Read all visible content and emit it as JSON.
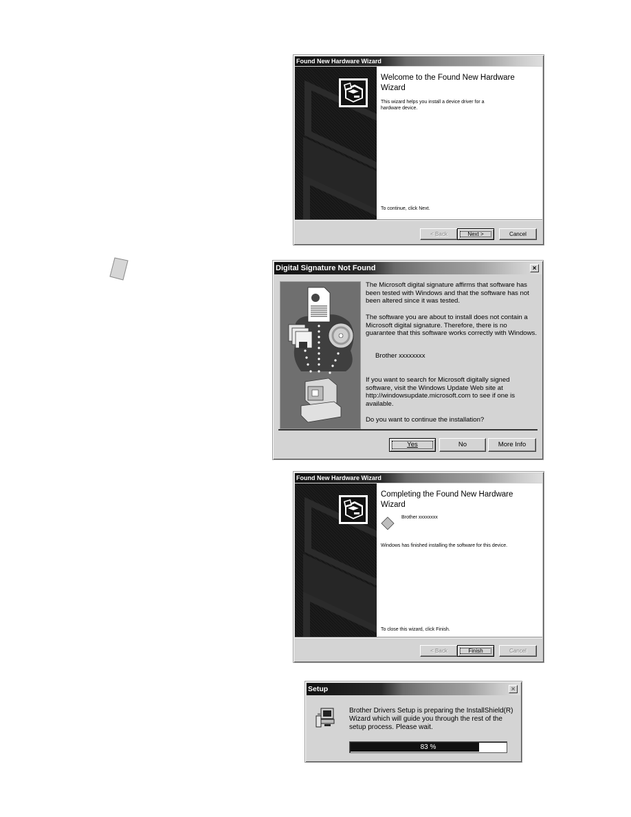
{
  "note_icon": "note-page-icon",
  "wizard_welcome": {
    "title": "Found New Hardware Wizard",
    "heading": "Welcome to the Found New Hardware Wizard",
    "description": "This wizard helps you install a device driver for a hardware device.",
    "footer": "To continue, click Next.",
    "icon": "hardware-box-icon",
    "buttons": {
      "back": "< Back",
      "next": "Next >",
      "cancel": "Cancel"
    }
  },
  "signature_dialog": {
    "title": "Digital Signature Not Found",
    "close_label": "×",
    "paragraph1": "The Microsoft digital signature affirms that software has been tested with Windows and that the software has not been altered since it was tested.",
    "paragraph2": "The software you are about to install does not contain a Microsoft digital signature. Therefore, there is no guarantee that this software works correctly with Windows.",
    "device_name": "Brother xxxxxxxx",
    "paragraph3": "If you want to search for Microsoft digitally signed software, visit the Windows Update Web site at http://windowsupdate.microsoft.com to see if one is available.",
    "question": "Do you want to continue the installation?",
    "illustration": "signature-illustration",
    "buttons": {
      "yes": "Yes",
      "no": "No",
      "more_info": "More Info"
    }
  },
  "wizard_complete": {
    "title": "Found New Hardware Wizard",
    "heading": "Completing the Found New Hardware Wizard",
    "device_name": "Brother xxxxxxxx",
    "status": "Windows has finished installing the software for this device.",
    "footer": "To close this wizard, click Finish.",
    "icon": "hardware-box-icon",
    "buttons": {
      "back": "< Back",
      "finish": "Finish",
      "cancel": "Cancel"
    }
  },
  "setup_dialog": {
    "title": "Setup",
    "close_label": "×",
    "message": "Brother Drivers Setup is preparing the InstallShield(R) Wizard which will guide you through the rest of the setup process.  Please wait.",
    "progress_percent": 83,
    "progress_label": "83 %"
  }
}
